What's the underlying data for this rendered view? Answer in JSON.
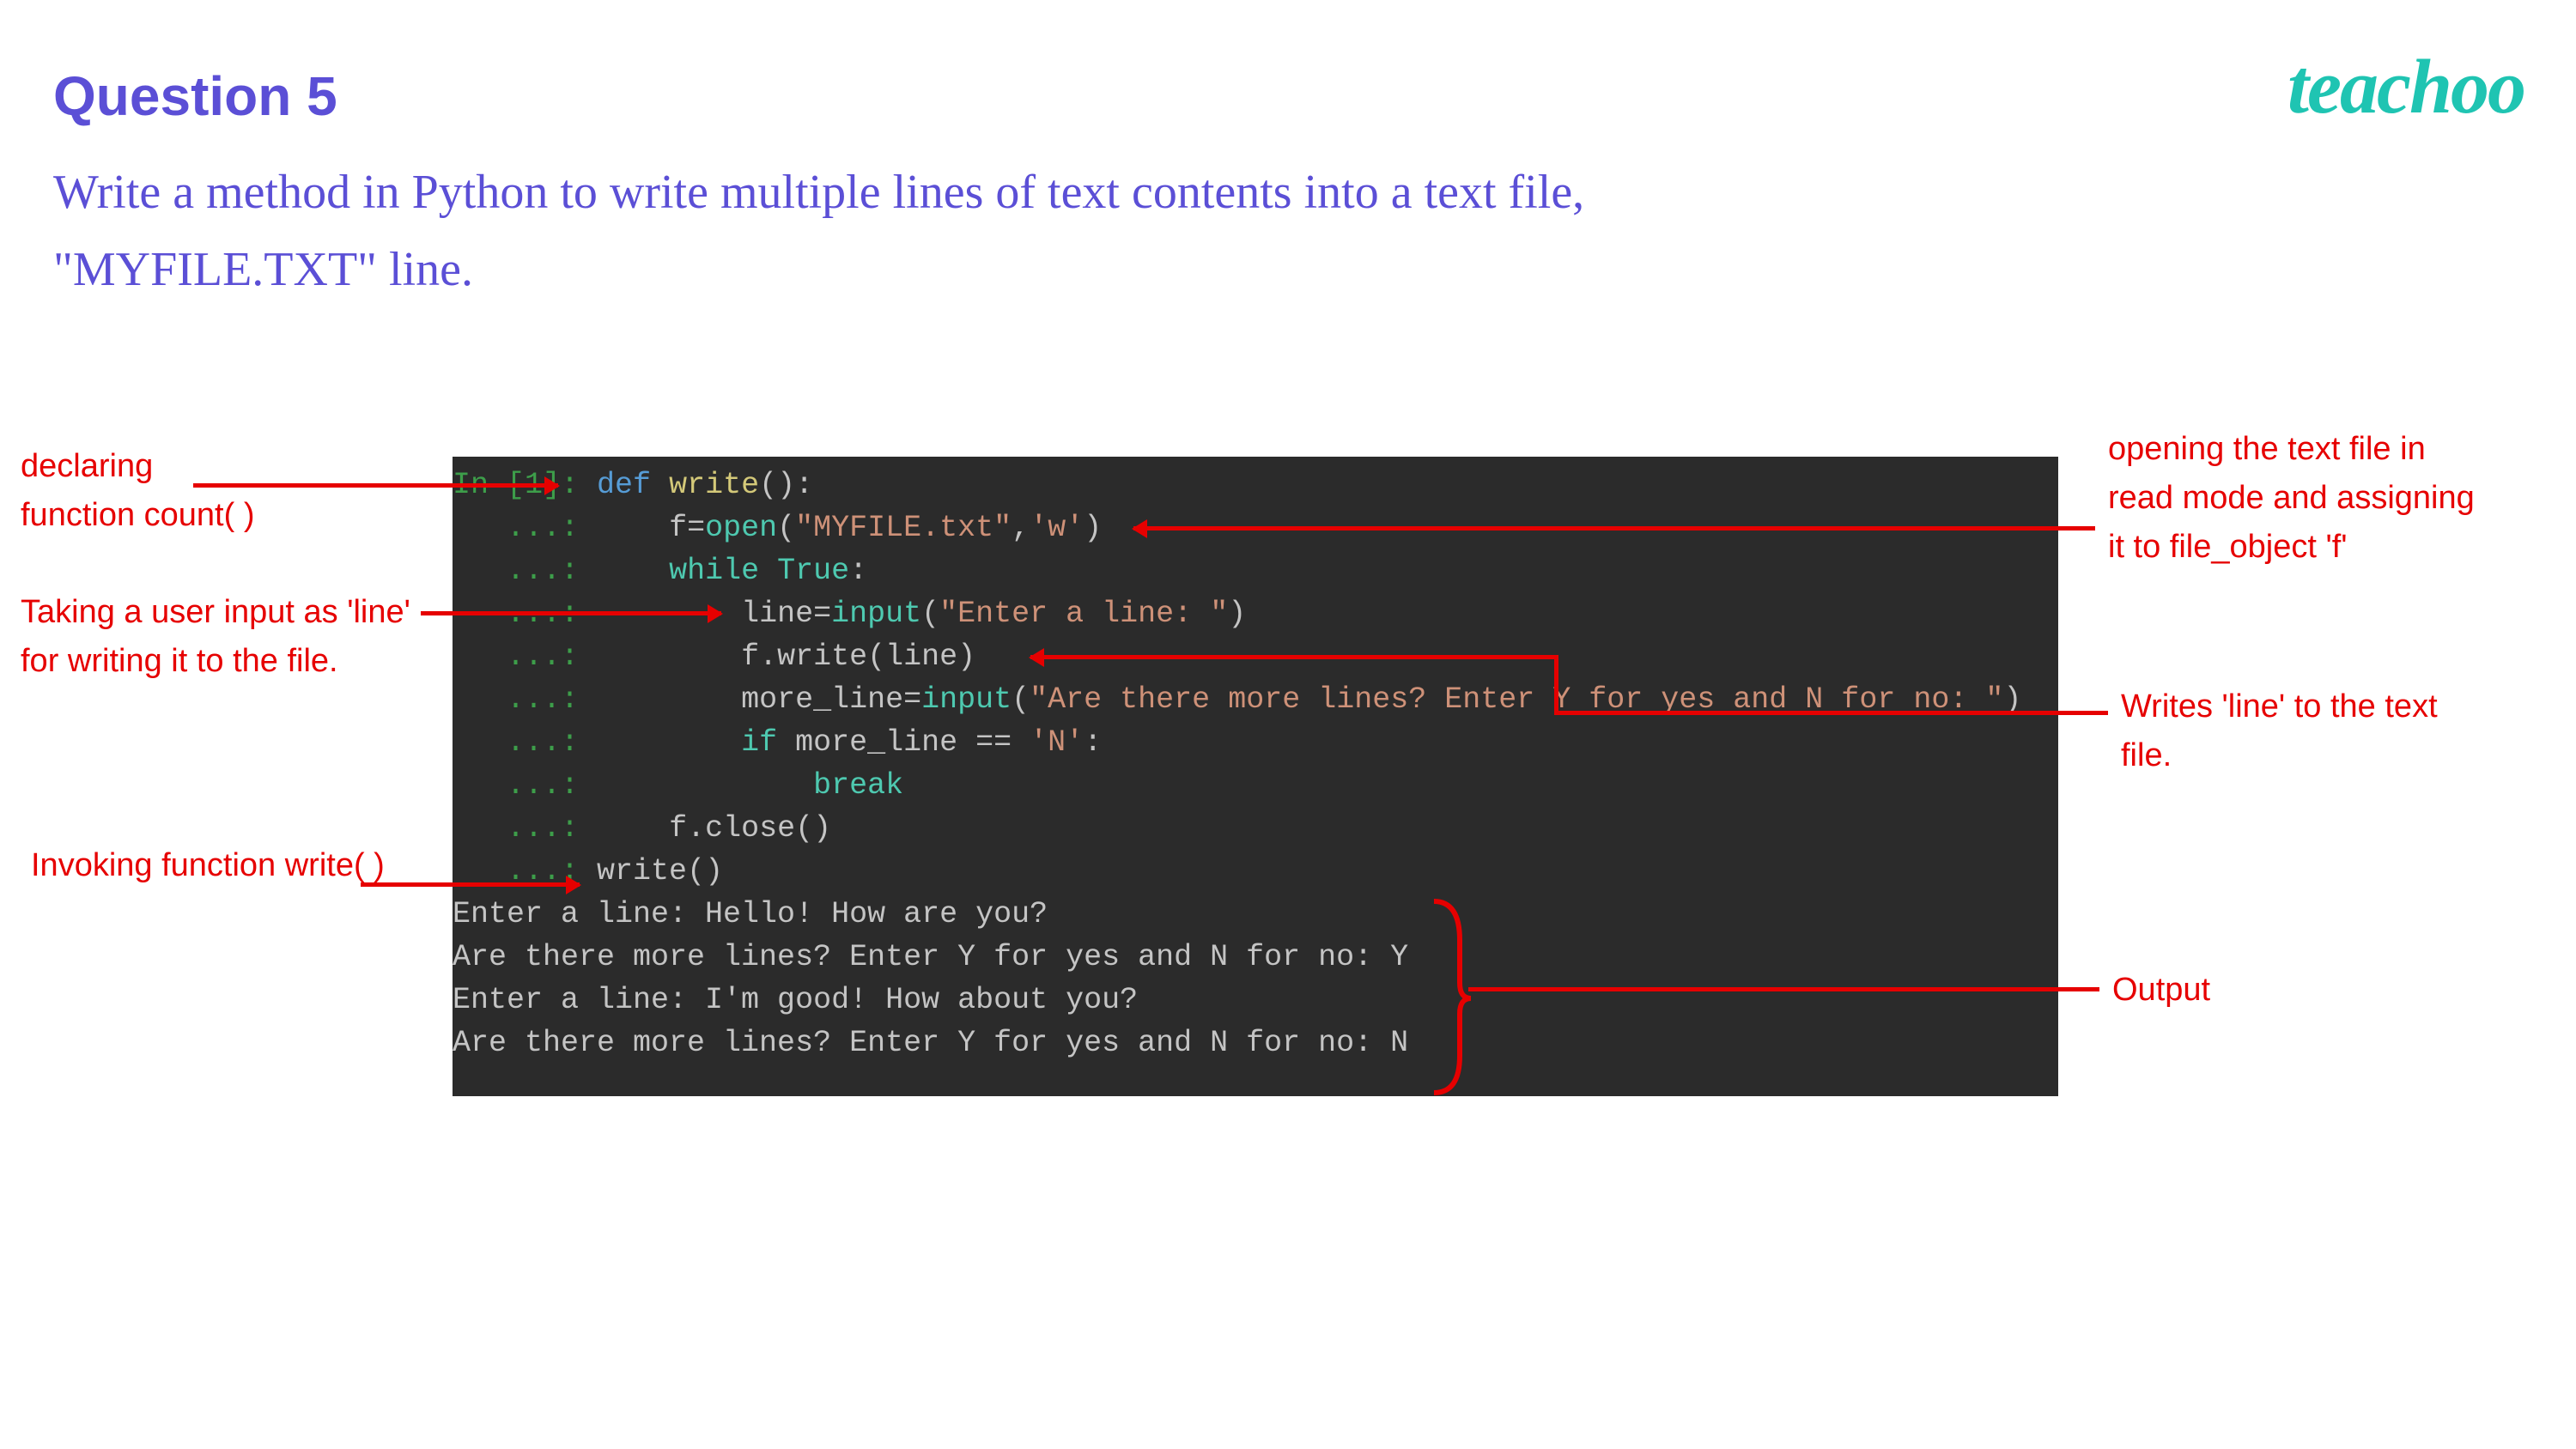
{
  "title": "Question 5",
  "subtitle": "Write a method in Python to write multiple lines  of text contents into a text file, \"MYFILE.TXT\" line.",
  "logo": "teachoo",
  "code": {
    "l1_prompt": "In [1]:",
    "l1_def": "def",
    "l1_fn": "write",
    "l1_rest": "():",
    "cont": "   ...:",
    "l2_var": "f",
    "l2_open": "open",
    "l2_str1": "\"MYFILE.txt\"",
    "l2_str2": "'w'",
    "l3_while": "while",
    "l3_true": "True",
    "l4_var": "line",
    "l4_input": "input",
    "l4_str": "\"Enter a line: \"",
    "l5_call": "f.write(line)",
    "l6_var": "more_line",
    "l6_input": "input",
    "l6_str": "\"Are there more lines? Enter Y for yes and N for no: \"",
    "l7_if": "if",
    "l7_cond": "more_line",
    "l7_eq": "==",
    "l7_str": "'N'",
    "l8_break": "break",
    "l9_close": "f.close()",
    "l10_call": "write()",
    "out1": "Enter a line: Hello! How are you?",
    "out2": "Are there more lines? Enter Y for yes and N for no: Y",
    "out3": "Enter a line: I'm good! How about you?",
    "out4": "Are there more lines? Enter Y for yes and N for no: N"
  },
  "annotations": {
    "declare": "declaring\nfunction count( )",
    "input_line": "Taking a user input as 'line' for writing it to the file.",
    "invoke": "Invoking function write( )",
    "open_file": "opening the text file in read mode and assigning it to file_object 'f'",
    "write_line": "Writes 'line' to the text file.",
    "output": "Output"
  }
}
